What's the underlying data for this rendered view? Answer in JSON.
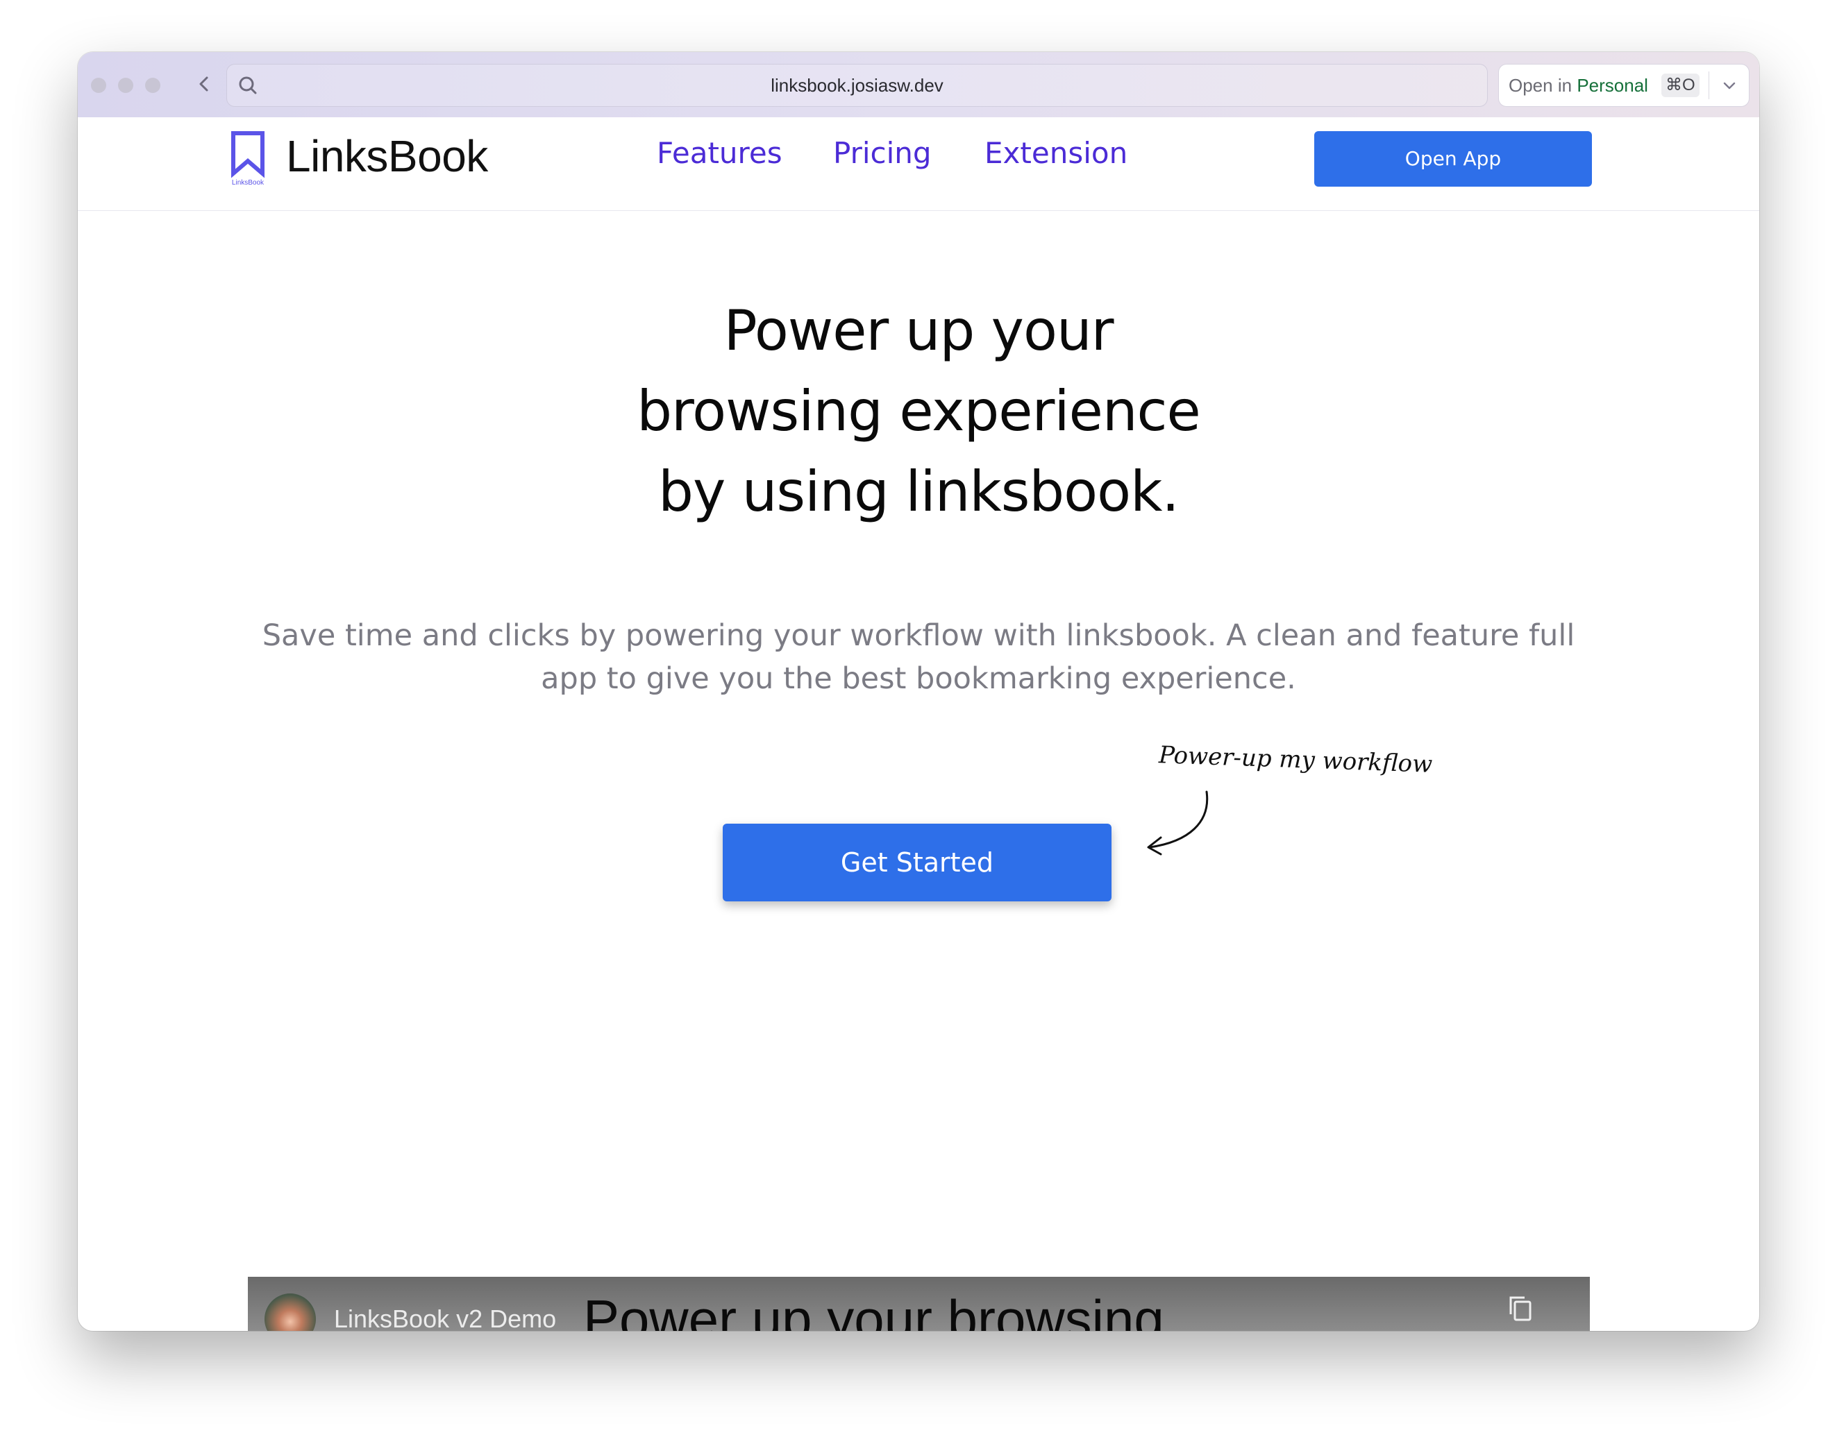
{
  "browser": {
    "url": "linksbook.josiasw.dev",
    "open_in_prefix": "Open in",
    "open_in_profile": "Personal",
    "open_in_shortcut": "⌘O"
  },
  "nav": {
    "logo_text": "LinksBook",
    "logo_caption": "LinksBook",
    "links": [
      "Features",
      "Pricing",
      "Extension"
    ],
    "cta_label": "Open App"
  },
  "hero": {
    "title_lines": [
      "Power up your",
      "browsing experience",
      "by using linksbook."
    ],
    "subtitle_lines": [
      "Save time and clicks by powering your workflow with linksbook. A clean and feature full",
      "app to give you the best bookmarking experience."
    ],
    "annotation": "Power-up my workflow",
    "cta_label": "Get Started"
  },
  "video": {
    "channel_title": "LinksBook v2 Demo",
    "overlay_text": "Power up your browsing"
  },
  "colors": {
    "accent": "#2e6fe9",
    "nav_link": "#4b2bd6",
    "logo": "#5b54e8",
    "profile_green": "#16703a"
  },
  "icons": [
    "back-chevron-icon",
    "search-icon",
    "reader-icon",
    "link-icon",
    "chevron-down-icon",
    "bookmark-logo-icon",
    "curved-arrow-icon",
    "copy-icon"
  ]
}
